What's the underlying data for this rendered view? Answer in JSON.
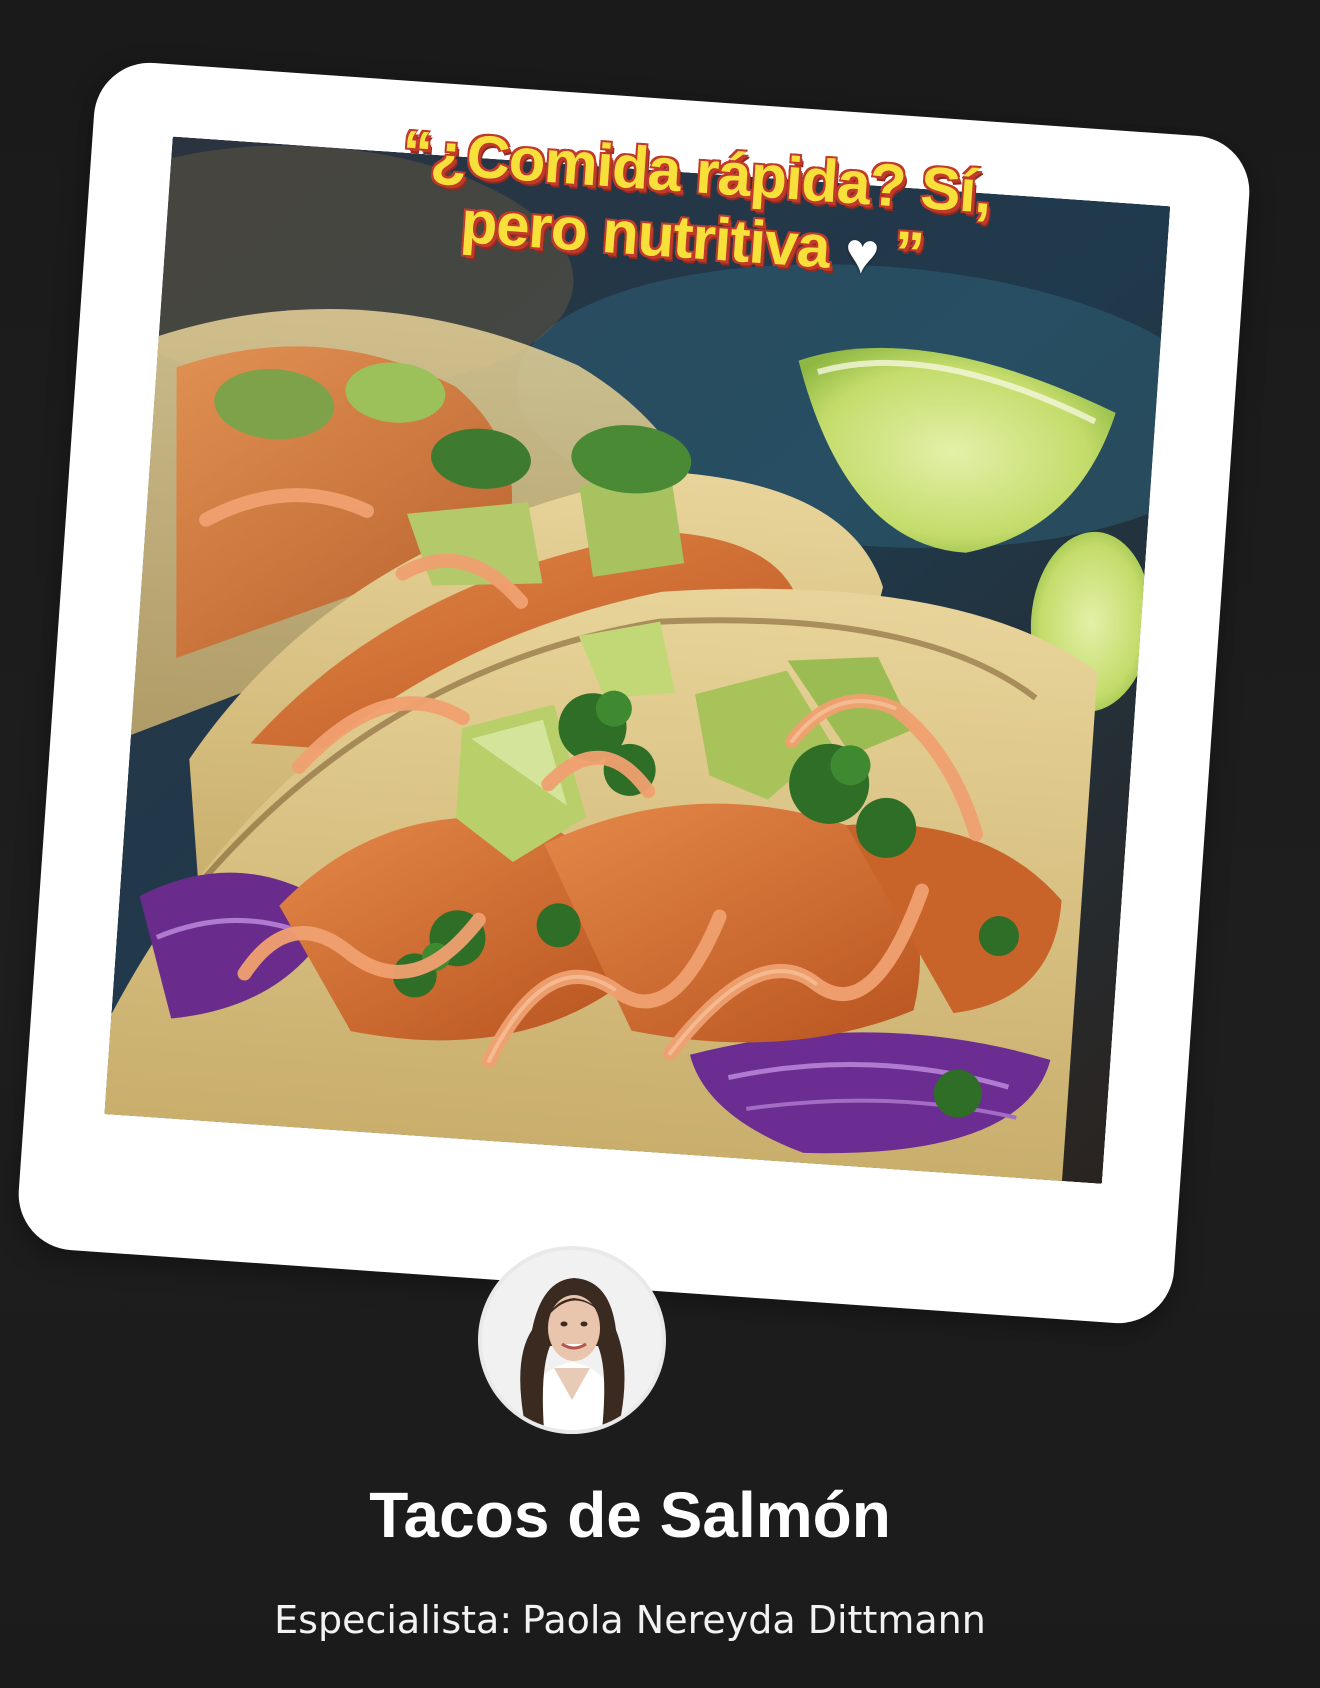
{
  "post": {
    "quote_line1": "“¿Comida rápida? Sí,",
    "quote_line2": "pero nutritiva",
    "quote_close": "”",
    "heart_icon": "white-heart-icon",
    "title": "Tacos de Salmón",
    "specialist_label": "Especialista:",
    "specialist_name": "Paola Nereyda Dittmann"
  },
  "colors": {
    "background": "#1c1c1c",
    "frame": "#ffffff",
    "quote_text": "#f8e03a",
    "quote_outline": "#c0392b",
    "title_text": "#ffffff"
  },
  "photo": {
    "subject": "salmon tacos with avocado, cilantro, red cabbage and chipotle sauce, lime wedges"
  },
  "avatar": {
    "subject": "profile-photo"
  }
}
